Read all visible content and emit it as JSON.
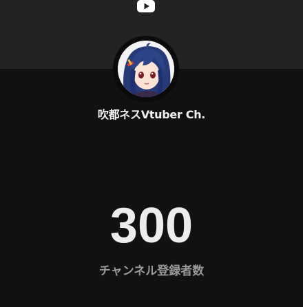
{
  "header": {
    "icon": "youtube-icon",
    "banner_color": "#232323",
    "icon_color": "#ffffff"
  },
  "channel": {
    "avatar": "vtuber-avatar",
    "name": "吹都ネスVtuber Ch."
  },
  "stats": {
    "subscriber_count": "300",
    "subscriber_label": "チャンネル登録者数"
  },
  "colors": {
    "background": "#111111",
    "count_text": "#ececec",
    "label_text": "#9a9a9a"
  }
}
